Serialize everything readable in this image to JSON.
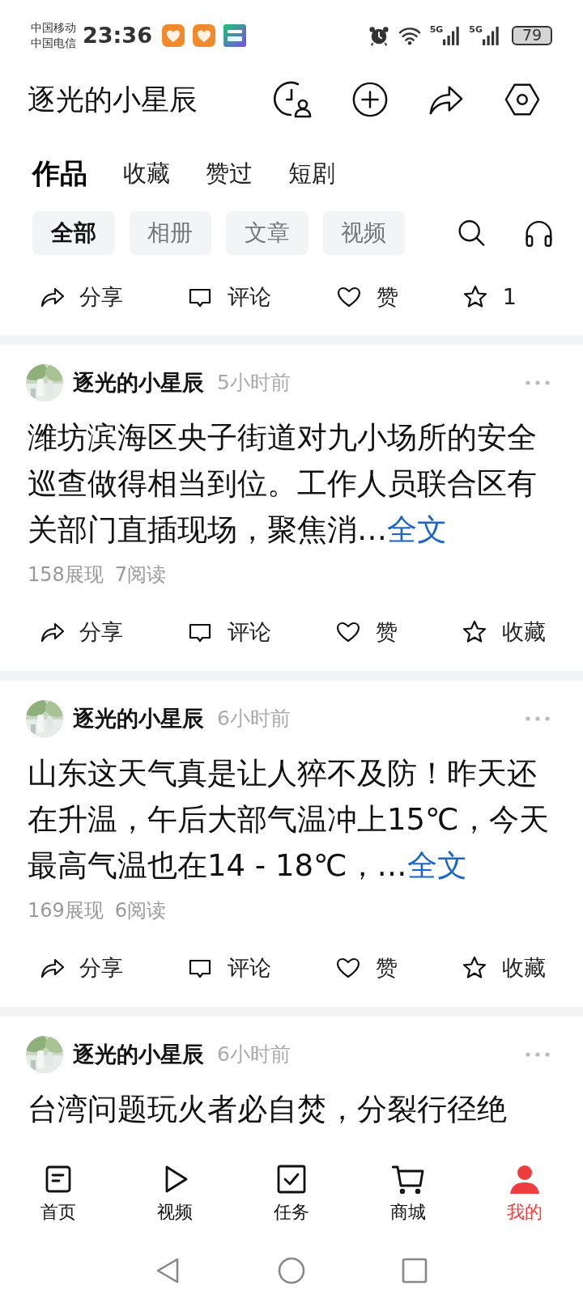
{
  "status_bar": {
    "carriers": [
      "中国移动",
      "中国电信"
    ],
    "time": "23:36",
    "signals": [
      {
        "label": "5G"
      },
      {
        "label": "5G"
      }
    ],
    "battery": "79"
  },
  "header": {
    "title": "逐光的小星辰"
  },
  "tabs": [
    {
      "label": "作品",
      "selected": true
    },
    {
      "label": "收藏",
      "selected": false
    },
    {
      "label": "赞过",
      "selected": false
    },
    {
      "label": "短剧",
      "selected": false
    }
  ],
  "filters": [
    {
      "label": "全部",
      "selected": true
    },
    {
      "label": "相册",
      "selected": false
    },
    {
      "label": "文章",
      "selected": false
    },
    {
      "label": "视频",
      "selected": false
    }
  ],
  "top_actions": [
    {
      "kind": "share",
      "label": "分享"
    },
    {
      "kind": "comment",
      "label": "评论"
    },
    {
      "kind": "like",
      "label": "赞"
    },
    {
      "kind": "favorite",
      "label": "1"
    }
  ],
  "posts": [
    {
      "author": "逐光的小星辰",
      "time": "5小时前",
      "text": "潍坊滨海区央子街道对九小场所的安全巡查做得相当到位。工作人员联合区有关部门直插现场，聚焦消…",
      "more": "全文",
      "impressions": "158展现",
      "reads": "7阅读",
      "actions": [
        {
          "kind": "share",
          "label": "分享"
        },
        {
          "kind": "comment",
          "label": "评论"
        },
        {
          "kind": "like",
          "label": "赞"
        },
        {
          "kind": "favorite",
          "label": "收藏"
        }
      ]
    },
    {
      "author": "逐光的小星辰",
      "time": "6小时前",
      "text": "山东这天气真是让人猝不及防！昨天还在升温，午后大部气温冲上15℃，今天最高气温也在14 - 18℃，…",
      "more": "全文",
      "impressions": "169展现",
      "reads": "6阅读",
      "actions": [
        {
          "kind": "share",
          "label": "分享"
        },
        {
          "kind": "comment",
          "label": "评论"
        },
        {
          "kind": "like",
          "label": "赞"
        },
        {
          "kind": "favorite",
          "label": "收藏"
        }
      ]
    },
    {
      "author": "逐光的小星辰",
      "time": "6小时前",
      "text": "台湾问题玩火者必自焚，分裂行径绝"
    }
  ],
  "bottom_nav": [
    {
      "kind": "home",
      "label": "首页",
      "selected": false
    },
    {
      "kind": "video",
      "label": "视频",
      "selected": false
    },
    {
      "kind": "task",
      "label": "任务",
      "selected": false
    },
    {
      "kind": "mall",
      "label": "商城",
      "selected": false
    },
    {
      "kind": "me",
      "label": "我的",
      "selected": true
    }
  ]
}
